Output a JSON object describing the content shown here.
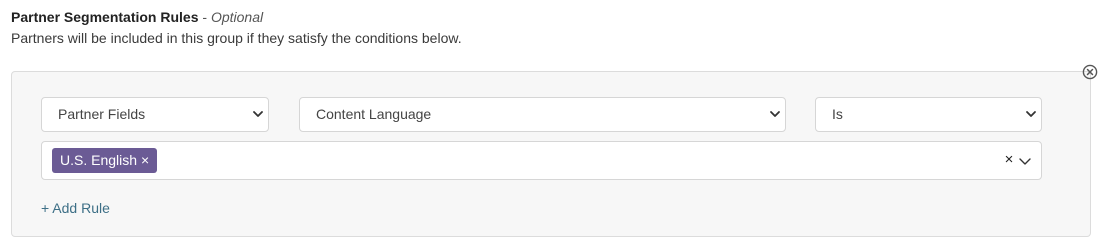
{
  "header": {
    "title": "Partner Segmentation Rules",
    "optional_separator": " - ",
    "optional_label": "Optional",
    "subtitle": "Partners will be included in this group if they satisfy the conditions below."
  },
  "rule": {
    "field_type": {
      "selected": "Partner Fields"
    },
    "field": {
      "selected": "Content Language"
    },
    "operator": {
      "selected": "Is"
    },
    "values": {
      "selected_tags": [
        {
          "label": "U.S. English",
          "remove_glyph": "×"
        }
      ],
      "clear_glyph": "×"
    }
  },
  "actions": {
    "add_rule_label": "+ Add Rule"
  },
  "icons": {
    "remove_rule": "circle-x-icon",
    "select_chevron": "chevron-down-icon",
    "clear": "clear-icon",
    "dropdown": "chevron-down-icon"
  },
  "colors": {
    "tag_background": "#6b5b95",
    "link": "#3d6f86",
    "panel_background": "#f7f7f7",
    "border": "#d6d6d6"
  }
}
